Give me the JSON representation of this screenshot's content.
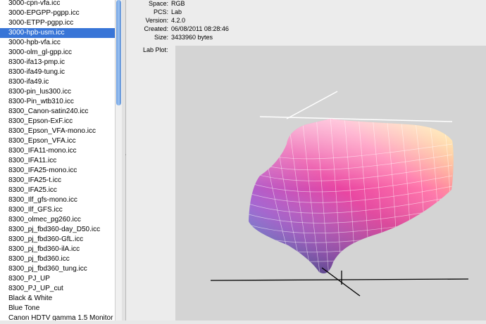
{
  "profiles": [
    "3000-cpn-vfa.icc",
    "3000-EPGPP-pgpp.icc",
    "3000-ETPP-pgpp.icc",
    "3000-hpb-usm.icc",
    "3000-hpb-vfa.icc",
    "3000-olm_gl-gpp.icc",
    "8300-ifa13-pmp.ic",
    "8300-ifa49-tung.ic",
    "8300-ifa49.ic",
    "8300-pin_lus300.icc",
    "8300-Pin_wtb310.icc",
    "8300_Canon-satin240.icc",
    "8300_Epson-ExF.icc",
    "8300_Epson_VFA-mono.icc",
    "8300_Epson_VFA.icc",
    "8300_IFA11-mono.icc",
    "8300_IFA11.icc",
    "8300_IFA25-mono.icc",
    "8300_IFA25-t.icc",
    "8300_IFA25.icc",
    "8300_Ilf_gfs-mono.icc",
    "8300_Ilf_GFS.icc",
    "8300_olmec_pg260.icc",
    "8300_pj_fbd360-day_D50.icc",
    "8300_pj_fbd360-GfL.icc",
    "8300_pj_fbd360-ilA.icc",
    "8300_pj_fbd360.icc",
    "8300_pj_fbd360_tung.icc",
    "8300_PJ_UP",
    "8300_PJ_UP_cut",
    "Black & White",
    "Blue Tone",
    "Canon HDTV gamma 1.5 Monitor"
  ],
  "selected_profile": "3000-hpb-usm.icc",
  "info": {
    "space_label": "Space:",
    "space_value": "RGB",
    "pcs_label": "PCS:",
    "pcs_value": "Lab",
    "version_label": "Version:",
    "version_value": "4.2.0",
    "created_label": "Created:",
    "created_value": "06/08/2011 08:28:46",
    "size_label": "Size:",
    "size_value": "3433960 bytes"
  },
  "plot": {
    "label": "Lab Plot:",
    "dropdown_icon": "triangle-down-icon"
  },
  "colors": {
    "selection": "#3875d7",
    "plot_background": "#d4d4d4"
  }
}
